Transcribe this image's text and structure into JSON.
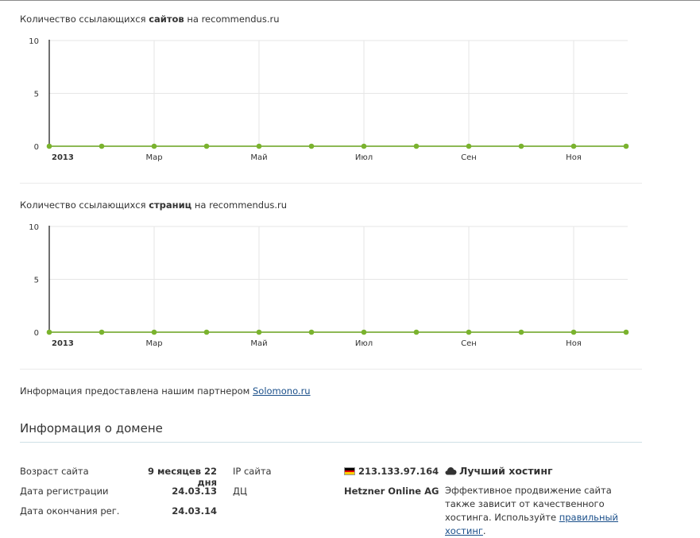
{
  "charts": [
    {
      "title_prefix": "Количество ссылающихся ",
      "title_bold": "сайтов",
      "title_suffix": " на recommendus.ru"
    },
    {
      "title_prefix": "Количество ссылающихся ",
      "title_bold": "страниц",
      "title_suffix": " на recommendus.ru"
    }
  ],
  "chart_data": [
    {
      "type": "line",
      "title": "Количество ссылающихся сайтов на recommendus.ru",
      "x": [
        "2013-01",
        "2013-02",
        "2013-03",
        "2013-04",
        "2013-05",
        "2013-06",
        "2013-07",
        "2013-08",
        "2013-09",
        "2013-10",
        "2013-11",
        "2013-12"
      ],
      "values": [
        0,
        0,
        0,
        0,
        0,
        0,
        0,
        0,
        0,
        0,
        0,
        0
      ],
      "x_tick_labels": [
        "2013",
        "Мар",
        "Май",
        "Июл",
        "Сен",
        "Ноя"
      ],
      "y_tick_labels": [
        "0",
        "5",
        "10"
      ],
      "ylim": [
        0,
        10
      ],
      "grid": true,
      "color": "#7ab32e"
    },
    {
      "type": "line",
      "title": "Количество ссылающихся страниц на recommendus.ru",
      "x": [
        "2013-01",
        "2013-02",
        "2013-03",
        "2013-04",
        "2013-05",
        "2013-06",
        "2013-07",
        "2013-08",
        "2013-09",
        "2013-10",
        "2013-11",
        "2013-12"
      ],
      "values": [
        0,
        0,
        0,
        0,
        0,
        0,
        0,
        0,
        0,
        0,
        0,
        0
      ],
      "x_tick_labels": [
        "2013",
        "Мар",
        "Май",
        "Июл",
        "Сен",
        "Ноя"
      ],
      "y_tick_labels": [
        "0",
        "5",
        "10"
      ],
      "ylim": [
        0,
        10
      ],
      "grid": true,
      "color": "#7ab32e"
    }
  ],
  "credit": {
    "text": "Информация предоставлена нашим партнером ",
    "link": "Solomono.ru"
  },
  "domain_info": {
    "title": "Информация о домене",
    "age_label": "Возраст сайта",
    "age_value": "9 месяцев 22 дня",
    "reg_label": "Дата регистрации",
    "reg_value": "24.03.13",
    "exp_label": "Дата окончания рег.",
    "exp_value": "24.03.14",
    "ip_label": "IP сайта",
    "ip_value": "213.133.97.164",
    "dc_label": "ДЦ",
    "dc_value": "Hetzner Online AG",
    "hosting_title": "Лучший хостинг",
    "hosting_text": "Эффективное продвижение сайта также зависит от качественного хостинга. Используйте ",
    "hosting_link": "правильный хостинг",
    "hosting_end": "."
  }
}
